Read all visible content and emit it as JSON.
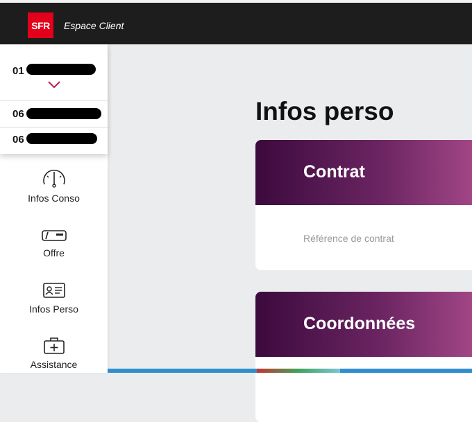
{
  "header": {
    "logo_text": "SFR",
    "app_title": "Espace Client"
  },
  "lines": {
    "current": "01",
    "others": [
      "06",
      "06"
    ]
  },
  "nav": {
    "items": [
      {
        "label": "Infos Conso",
        "icon": "gauge-icon"
      },
      {
        "label": "Offre",
        "icon": "box-offer-icon"
      },
      {
        "label": "Infos Perso",
        "icon": "id-card-icon"
      },
      {
        "label": "Assistance",
        "icon": "first-aid-kit-icon"
      }
    ]
  },
  "main": {
    "title": "Infos perso",
    "cards": [
      {
        "title": "Contrat",
        "field": "Référence de contrat"
      },
      {
        "title": "Coordonnées",
        "field": ""
      }
    ]
  },
  "colors": {
    "brand": "#e2001a",
    "card_gradient_start": "#3c0a3d",
    "card_gradient_end": "#a94a8a",
    "accent_chevron": "#c2185b"
  }
}
